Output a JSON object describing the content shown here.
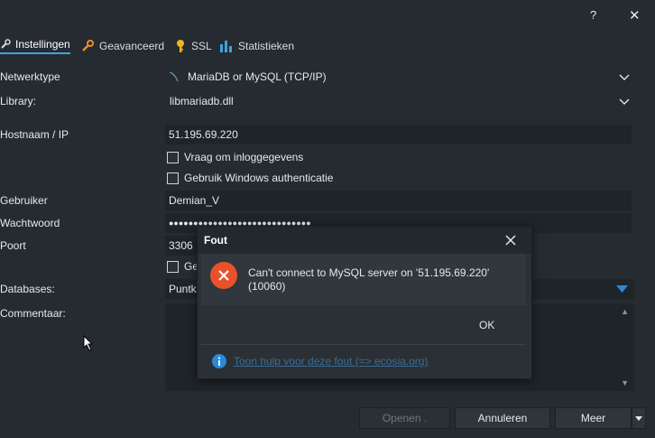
{
  "window": {
    "help_label": "?",
    "close_label": "✕"
  },
  "tabs": [
    {
      "label": "Instellingen",
      "icon": "wrench-icon"
    },
    {
      "label": "Geavanceerd",
      "icon": "wrench-orange-icon"
    },
    {
      "label": "SSL",
      "icon": "key-icon"
    },
    {
      "label": "Statistieken",
      "icon": "bar-chart-icon"
    }
  ],
  "form": {
    "network_type_label": "Netwerktype",
    "network_type_value": "MariaDB or MySQL (TCP/IP)",
    "library_label": "Library:",
    "library_value": "libmariadb.dll",
    "hostname_label": "Hostnaam / IP",
    "hostname_value": "51.195.69.220",
    "ask_login_label": "Vraag om inloggegevens",
    "windows_auth_label": "Gebruik Windows authenticatie",
    "user_label": "Gebruiker",
    "user_value": "Demian_V",
    "password_label": "Wachtwoord",
    "password_value": "●●●●●●●●●●●●●●●●●●●●●●●●●●●●●",
    "port_label": "Poort",
    "port_value": "3306",
    "compression_label_partial": "Ge",
    "databases_label": "Databases:",
    "databases_value_partial": "Puntk",
    "comment_label": "Commentaar:"
  },
  "buttons": {
    "open_label": "Openen .",
    "cancel_label": "Annuleren",
    "more_label": "Meer"
  },
  "dialog": {
    "title": "Fout",
    "message": "Can't connect to MySQL server on '51.195.69.220' (10060)",
    "ok_label": "OK",
    "help_link": "Toon hulp voor deze fout (=> ecosia.org)"
  },
  "colors": {
    "background": "#252b30",
    "field": "#1f2428",
    "accent": "#3ca3e0",
    "error": "#e8522a",
    "info": "#2a8ad8"
  }
}
